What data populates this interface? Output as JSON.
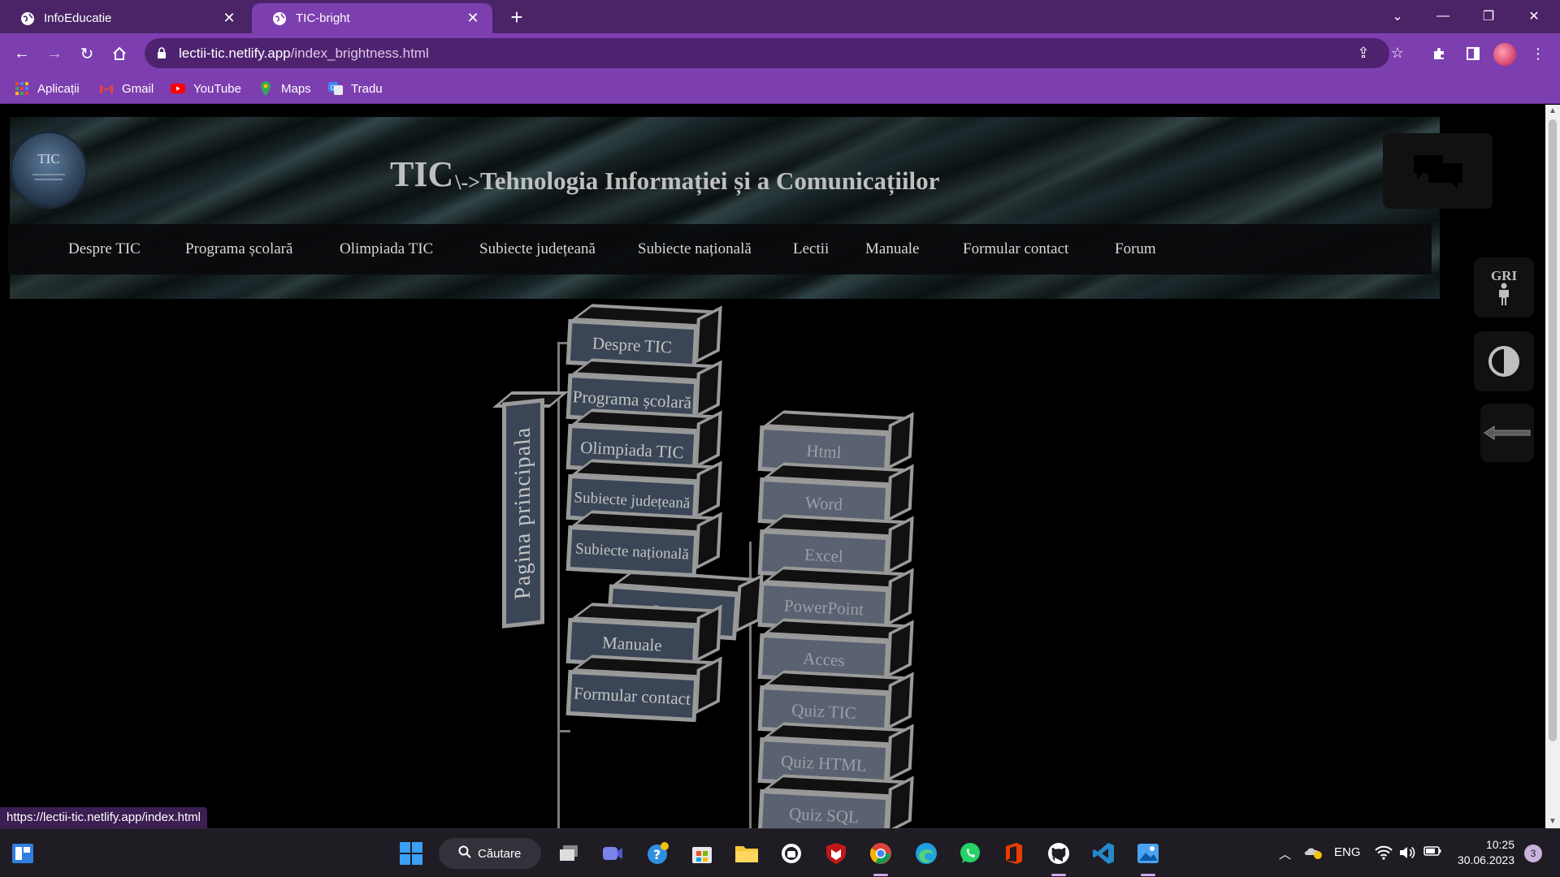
{
  "browser": {
    "tabs": [
      {
        "title": "InfoEducatie",
        "active": false
      },
      {
        "title": "TIC-bright",
        "active": true
      }
    ],
    "url_host": "lectii-tic.netlify.app",
    "url_path": "/index_brightness.html",
    "bookmarks": [
      {
        "label": "Aplicații",
        "icon": "apps-grid-icon"
      },
      {
        "label": "Gmail",
        "icon": "gmail-icon"
      },
      {
        "label": "YouTube",
        "icon": "youtube-icon"
      },
      {
        "label": "Maps",
        "icon": "maps-icon"
      },
      {
        "label": "Tradu",
        "icon": "translate-icon"
      }
    ],
    "status_url": "https://lectii-tic.netlify.app/index.html",
    "accent": "#7d3fb0",
    "tabbar_color": "#4a2466"
  },
  "page": {
    "logo_text": "TIC",
    "title_main": "TIC",
    "title_arrow": "\\->",
    "title_rest": "Tehnologia Informației și a Comunicațiilor",
    "nav": [
      "Despre TIC",
      "Programa școlară",
      "Olimpiada TIC",
      "Subiecte județeană",
      "Subiecte națională",
      "Lectii",
      "Manuale",
      "Formular contact",
      "Forum"
    ],
    "side_buttons": {
      "gri_label": "GRI"
    },
    "diagram": {
      "root": "Pagina principala",
      "left_column": [
        "Despre TIC",
        "Programa școlară",
        "Olimpiada TIC",
        "Subiecte județeană",
        "Subiecte națională",
        "Manuale",
        "Formular contact"
      ],
      "middle": "Lectii",
      "right_column": [
        "Html",
        "Word",
        "Excel",
        "PowerPoint",
        "Acces",
        "Quiz TIC",
        "Quiz HTML",
        "Quiz SQL"
      ]
    }
  },
  "taskbar": {
    "search_label": "Căutare",
    "language": "ENG",
    "time": "10:25",
    "date": "30.06.2023",
    "notifications": "3"
  }
}
